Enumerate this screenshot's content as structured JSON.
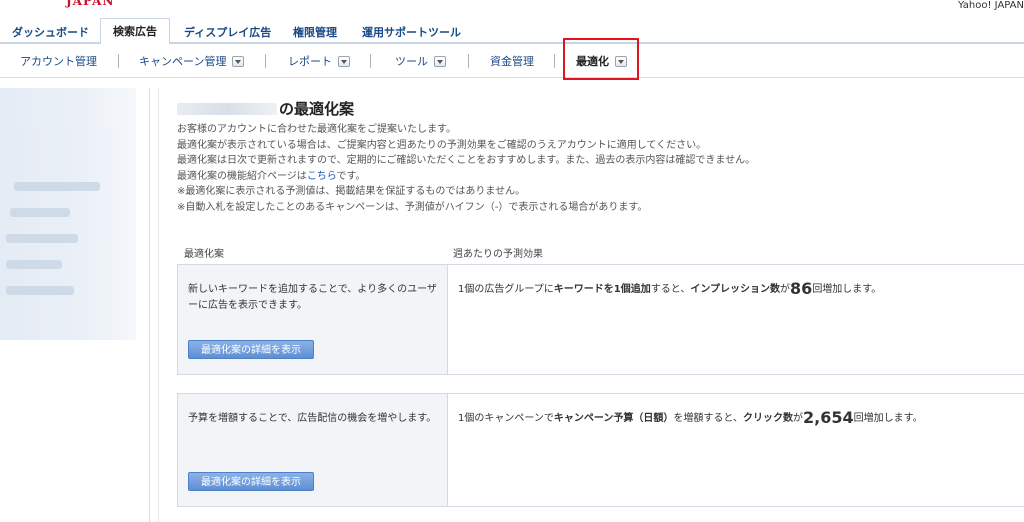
{
  "header": {
    "logo_fragment": "JAPAN",
    "user": "Yahoo! JAPAN"
  },
  "main_tabs": [
    {
      "label": "ダッシュボード"
    },
    {
      "label": "検索広告"
    },
    {
      "label": "ディスプレイ広告"
    },
    {
      "label": "権限管理"
    },
    {
      "label": "運用サポートツール"
    }
  ],
  "sub_nav": [
    {
      "label": "アカウント管理"
    },
    {
      "label": "キャンペーン管理"
    },
    {
      "label": "レポート"
    },
    {
      "label": "ツール"
    },
    {
      "label": "資金管理"
    },
    {
      "label": "最適化"
    }
  ],
  "page": {
    "title_suffix": "の最適化案",
    "desc_lines": [
      "お客様のアカウントに合わせた最適化案をご提案いたします。",
      "最適化案が表示されている場合は、ご提案内容と週あたりの予測効果をご確認のうえアカウントに適用してください。",
      "最適化案は日次で更新されますので、定期的にご確認いただくことをおすすめします。また、過去の表示内容は確認できません。"
    ],
    "link_line_prefix": "最適化案の機能紹介ページは",
    "link_text": "こちら",
    "link_line_suffix": "です。",
    "notes": [
      "※最適化案に表示される予測値は、掲載結果を保証するものではありません。",
      "※自動入札を設定したことのあるキャンペーンは、予測値がハイフン（-）で表示される場合があります。"
    ]
  },
  "table": {
    "col1": "最適化案",
    "col2": "週あたりの予測効果",
    "button_label": "最適化案の詳細を表示",
    "rows": [
      {
        "suggestion": "新しいキーワードを追加することで、より多くのユーザーに広告を表示できます。",
        "e1": "1個の広告グループに",
        "e2": "キーワードを1個追加",
        "e3": "すると、",
        "e4": "インプレッション数",
        "e5": "が",
        "num": "86",
        "e6": "回増加します。"
      },
      {
        "suggestion": "予算を増額することで、広告配信の機会を増やします。",
        "e1": "1個のキャンペーンで",
        "e2": "キャンペーン予算（日額）",
        "e3": "を増額すると、",
        "e4": "クリック数",
        "e5": "が",
        "num": "2,654",
        "e6": "回増加します。"
      }
    ]
  }
}
